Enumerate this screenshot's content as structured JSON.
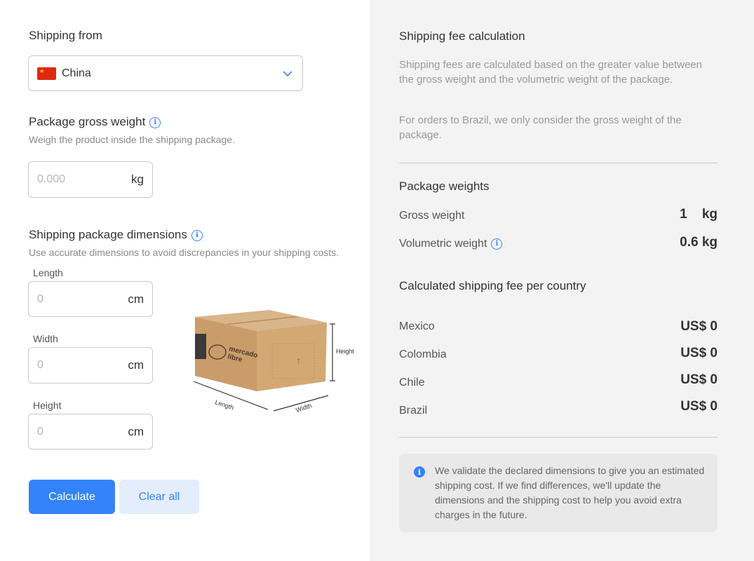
{
  "left": {
    "shipping_from": {
      "label": "Shipping from",
      "selected_country": "China",
      "flag_icon": "china-flag-icon",
      "chevron_icon": "chevron-down-icon"
    },
    "gross_weight": {
      "label": "Package gross weight",
      "info_icon": "info-icon",
      "hint": "Weigh the product inside the shipping package.",
      "placeholder": "0.000",
      "unit": "kg"
    },
    "dimensions": {
      "label": "Shipping package dimensions",
      "info_icon": "info-icon",
      "hint": "Use accurate dimensions to avoid discrepancies in your shipping costs.",
      "length": {
        "label": "Length",
        "placeholder": "0",
        "unit": "cm"
      },
      "width": {
        "label": "Width",
        "placeholder": "0",
        "unit": "cm"
      },
      "height": {
        "label": "Height",
        "placeholder": "0",
        "unit": "cm"
      },
      "illustration": {
        "brand_line1": "mercado",
        "brand_line2": "libre",
        "length_label": "Length",
        "width_label": "Width",
        "height_label": "Height"
      }
    },
    "buttons": {
      "calculate": "Calculate",
      "clear_all": "Clear all"
    }
  },
  "right": {
    "fee_title": "Shipping fee calculation",
    "fee_text_1": "Shipping fees are calculated based on the greater value between the gross weight and the volumetric weight of the package.",
    "fee_text_2": "For orders to Brazil, we only consider the gross weight of the package.",
    "weights_title": "Package weights",
    "gross_weight_label": "Gross weight",
    "gross_weight_value": "1",
    "gross_weight_unit": "kg",
    "volumetric_weight_label": "Volumetric weight",
    "volumetric_weight_value": "0.6 kg",
    "per_country_title": "Calculated shipping fee per country",
    "countries": [
      {
        "name": "Mexico",
        "fee": "US$ 0"
      },
      {
        "name": "Colombia",
        "fee": "US$ 0"
      },
      {
        "name": "Chile",
        "fee": "US$ 0"
      },
      {
        "name": "Brazil",
        "fee": "US$ 0"
      }
    ],
    "notice": "We validate the declared dimensions to give you an estimated shipping cost. If we find differences, we'll update the dimensions and the shipping cost to help you avoid extra charges in the future."
  },
  "colors": {
    "accent": "#3483fa",
    "right_panel_bg": "#f3f3f3",
    "secondary_button_bg": "#e3edfb"
  }
}
